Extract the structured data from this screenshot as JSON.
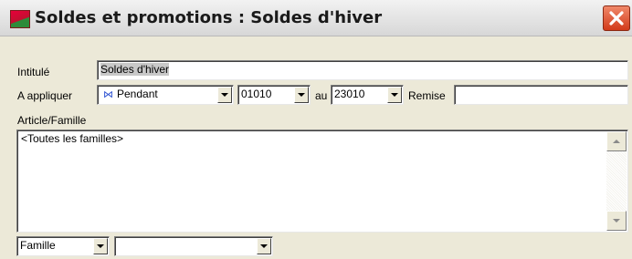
{
  "window": {
    "title": "Soldes et promotions : Soldes d'hiver"
  },
  "form": {
    "intitule_label": "Intitulé",
    "intitule_value": "Soldes d'hiver",
    "appliquer_label": "A appliquer",
    "mode_value": "Pendant",
    "date_start": "01010",
    "au_label": "au",
    "date_end": "23010",
    "remise_label": "Remise",
    "remise_value": "",
    "article_label": "Article/Famille",
    "list_items": [
      "<Toutes les familles>"
    ],
    "type_value": "Famille",
    "famille_value": ""
  },
  "icons": {
    "close": "close-icon",
    "app": "app-icon",
    "mode": "bowtie-icon"
  },
  "colors": {
    "background": "#ece9d8",
    "close_button": "#d23a1a"
  }
}
